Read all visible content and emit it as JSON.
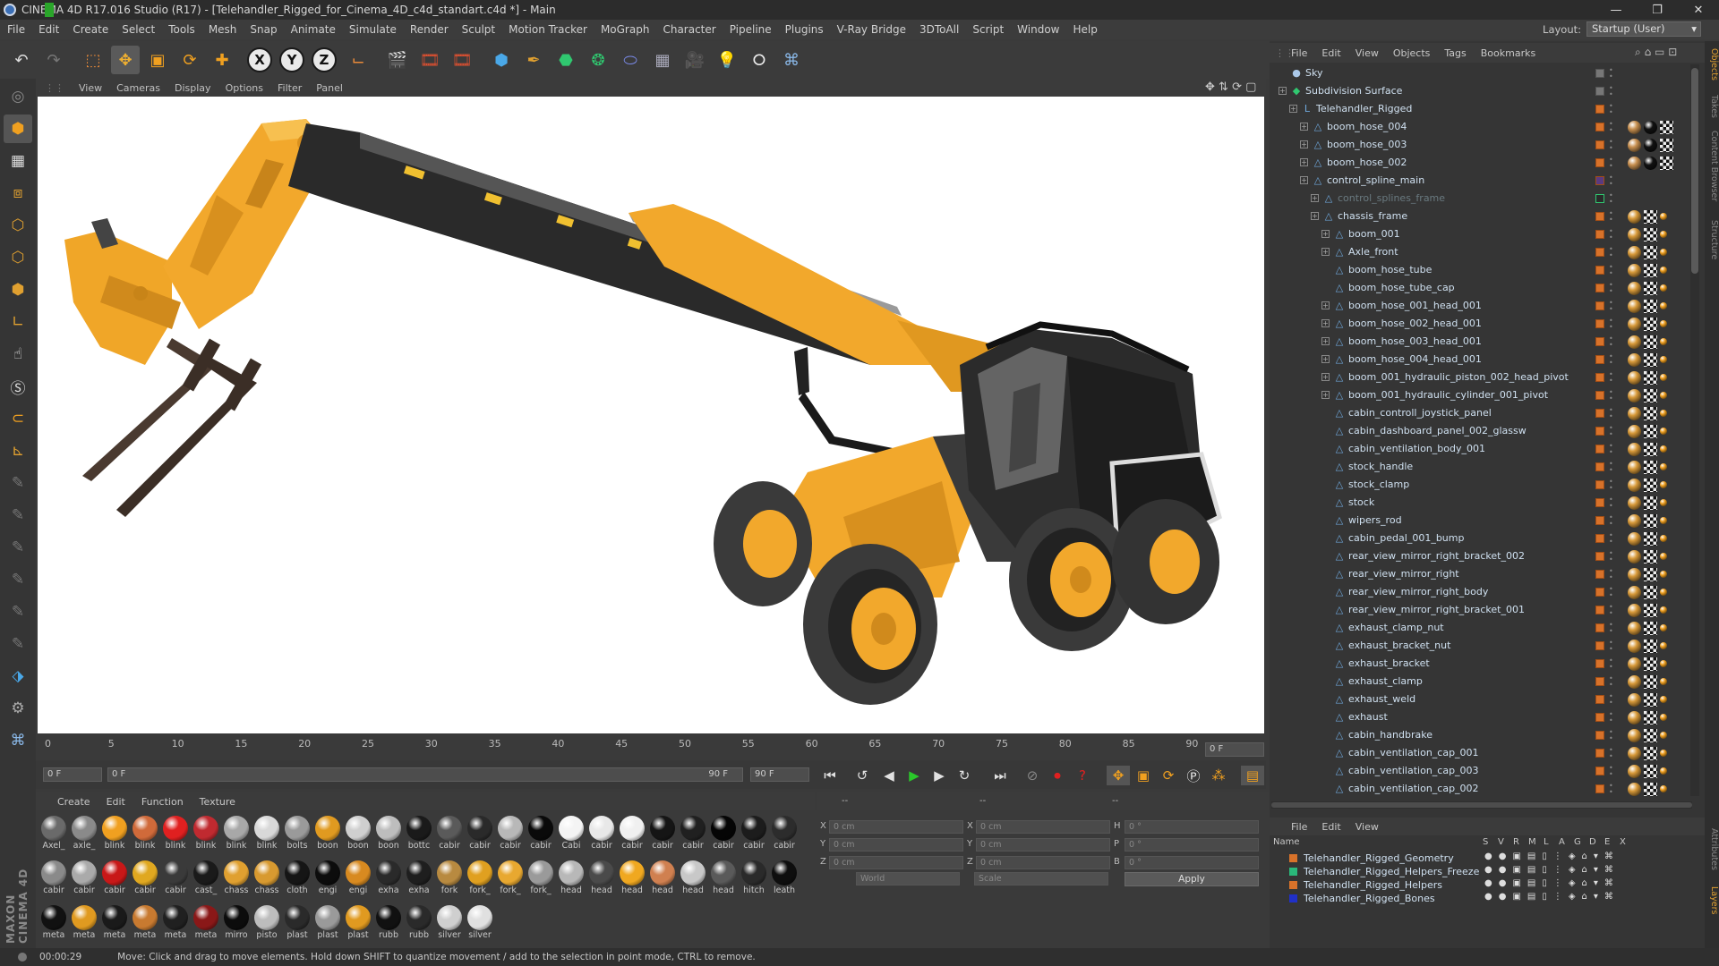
{
  "app": {
    "title": "CINEMA 4D R17.016 Studio (R17) - [Telehandler_Rigged_for_Cinema_4D_c4d_standart.c4d *] - Main"
  },
  "menu": [
    "File",
    "Edit",
    "Create",
    "Select",
    "Tools",
    "Mesh",
    "Snap",
    "Animate",
    "Simulate",
    "Render",
    "Sculpt",
    "Motion Tracker",
    "MoGraph",
    "Character",
    "Pipeline",
    "Plugins",
    "V-Ray Bridge",
    "3DToAll",
    "Script",
    "Window",
    "Help"
  ],
  "layout": {
    "label": "Layout:",
    "value": "Startup (User)"
  },
  "viewport": {
    "menu": [
      "View",
      "Cameras",
      "Display",
      "Options",
      "Filter",
      "Panel"
    ]
  },
  "timeline": {
    "ticks": [
      "0",
      "5",
      "10",
      "15",
      "20",
      "25",
      "30",
      "35",
      "40",
      "45",
      "50",
      "55",
      "60",
      "65",
      "70",
      "75",
      "80",
      "85",
      "90"
    ],
    "frame_end_display": "0 F"
  },
  "playback": {
    "start": "0 F",
    "range_start": "0 F",
    "range_end": "90 F",
    "end": "90 F"
  },
  "materials_menu": [
    "Create",
    "Edit",
    "Function",
    "Texture"
  ],
  "materials": [
    {
      "n": "Axel_",
      "c": "#6a6a6a"
    },
    {
      "n": "axle_",
      "c": "#8a8a8a"
    },
    {
      "n": "blink",
      "c": "#f0a020"
    },
    {
      "n": "blink",
      "c": "#d06a3a"
    },
    {
      "n": "blink",
      "c": "#e02020"
    },
    {
      "n": "blink",
      "c": "#c02a30"
    },
    {
      "n": "blink",
      "c": "#a8a8a8"
    },
    {
      "n": "blink",
      "c": "#d8d8d8"
    },
    {
      "n": "bolts",
      "c": "#9a9a9a"
    },
    {
      "n": "boon",
      "c": "#e09a20"
    },
    {
      "n": "boon",
      "c": "#cfcfcf"
    },
    {
      "n": "boon",
      "c": "#bdbdbd"
    },
    {
      "n": "bottc",
      "c": "#1a1a1a"
    },
    {
      "n": "cabir",
      "c": "#5a5a5a"
    },
    {
      "n": "cabir",
      "c": "#2a2a2a"
    },
    {
      "n": "cabir",
      "c": "#b8b8b8"
    },
    {
      "n": "cabir",
      "c": "#0a0a0a"
    },
    {
      "n": "Cabi",
      "c": "#f4f4f4"
    },
    {
      "n": "cabir",
      "c": "#e8e8e8"
    },
    {
      "n": "cabir",
      "c": "#f0f0f0"
    },
    {
      "n": "cabir",
      "c": "#151515"
    },
    {
      "n": "cabir",
      "c": "#202020"
    },
    {
      "n": "cabir",
      "c": "#050505"
    },
    {
      "n": "cabir",
      "c": "#1c1c1c"
    },
    {
      "n": "cabir",
      "c": "#2c2c2c"
    },
    {
      "n": "cabir",
      "c": "#8a8a8a"
    },
    {
      "n": "cabir",
      "c": "#aaaaaa"
    },
    {
      "n": "cabir",
      "c": "#c81818"
    },
    {
      "n": "cabir",
      "c": "#e0a820"
    },
    {
      "n": "cabir",
      "c": "#3a3a3a"
    },
    {
      "n": "cast_",
      "c": "#1a1a1a"
    },
    {
      "n": "chass",
      "c": "#e0a030"
    },
    {
      "n": "chass",
      "c": "#d89a30"
    },
    {
      "n": "cloth",
      "c": "#151515"
    },
    {
      "n": "engi",
      "c": "#0c0c0c"
    },
    {
      "n": "engi",
      "c": "#d88a20"
    },
    {
      "n": "exha",
      "c": "#2a2a2a"
    },
    {
      "n": "exha",
      "c": "#1e1e1e"
    },
    {
      "n": "fork",
      "c": "#b88a40"
    },
    {
      "n": "fork_",
      "c": "#e0a020"
    },
    {
      "n": "fork_",
      "c": "#e8a830"
    },
    {
      "n": "fork_",
      "c": "#9a9a9a"
    },
    {
      "n": "head",
      "c": "#b8b8b8"
    },
    {
      "n": "head",
      "c": "#4a4a4a"
    },
    {
      "n": "head",
      "c": "#f0a820"
    },
    {
      "n": "head",
      "c": "#d08050"
    },
    {
      "n": "head",
      "c": "#c8c8c8"
    },
    {
      "n": "head",
      "c": "#5a5a5a"
    },
    {
      "n": "hitch",
      "c": "#2a2a2a"
    },
    {
      "n": "leath",
      "c": "#0e0e0e"
    },
    {
      "n": "meta",
      "c": "#111111"
    },
    {
      "n": "meta",
      "c": "#e09a20"
    },
    {
      "n": "meta",
      "c": "#1a1a1a"
    },
    {
      "n": "meta",
      "c": "#c87a30"
    },
    {
      "n": "meta",
      "c": "#202020"
    },
    {
      "n": "meta",
      "c": "#8a1818"
    },
    {
      "n": "mirro",
      "c": "#0c0c0c"
    },
    {
      "n": "pisto",
      "c": "#bdbdbd"
    },
    {
      "n": "plast",
      "c": "#2a2a2a"
    },
    {
      "n": "plast",
      "c": "#9a9a9a"
    },
    {
      "n": "plast",
      "c": "#e09a20"
    },
    {
      "n": "rubb",
      "c": "#111111"
    },
    {
      "n": "rubb",
      "c": "#2a2a2a"
    },
    {
      "n": "silver",
      "c": "#cfcfcf"
    },
    {
      "n": "silver",
      "c": "#e0e0e0"
    }
  ],
  "coords": {
    "x": "0 cm",
    "y": "0 cm",
    "z": "0 cm",
    "x2": "0 cm",
    "y2": "0 cm",
    "z2": "0 cm",
    "h": "0 °",
    "p": "0 °",
    "b": "0 °",
    "mode1": "World",
    "mode2": "Scale",
    "apply": "Apply",
    "lx": "X",
    "ly": "Y",
    "lz": "Z",
    "lh": "H",
    "lp": "P",
    "lb": "B",
    "hdr": "--",
    "hdr2": "--",
    "hdr3": "--"
  },
  "status": {
    "time": "00:00:29",
    "text": "Move: Click and drag to move elements. Hold down SHIFT to quantize movement / add to the selection in point mode, CTRL to remove."
  },
  "objects_menu": [
    "File",
    "Edit",
    "View",
    "Objects",
    "Tags",
    "Bookmarks"
  ],
  "objects": [
    {
      "name": "Sky",
      "d": 0,
      "exp": false,
      "icon": "●",
      "dim": false
    },
    {
      "name": "Subdivision Surface",
      "d": 0,
      "exp": true,
      "icon": "◆",
      "dim": false
    },
    {
      "name": "Telehandler_Rigged",
      "d": 1,
      "exp": true,
      "icon": "L",
      "dim": false
    },
    {
      "name": "boom_hose_004",
      "d": 2,
      "exp": true,
      "icon": "△",
      "dim": false
    },
    {
      "name": "boom_hose_003",
      "d": 2,
      "exp": true,
      "icon": "△",
      "dim": false
    },
    {
      "name": "boom_hose_002",
      "d": 2,
      "exp": true,
      "icon": "△",
      "dim": false
    },
    {
      "name": "control_spline_main",
      "d": 2,
      "exp": true,
      "icon": "△",
      "dim": false
    },
    {
      "name": "control_splines_frame",
      "d": 3,
      "exp": true,
      "icon": "△",
      "dim": true
    },
    {
      "name": "chassis_frame",
      "d": 3,
      "exp": true,
      "icon": "△",
      "dim": false
    },
    {
      "name": "boom_001",
      "d": 4,
      "exp": true,
      "icon": "△",
      "dim": false
    },
    {
      "name": "Axle_front",
      "d": 4,
      "exp": true,
      "icon": "△",
      "dim": false
    },
    {
      "name": "boom_hose_tube",
      "d": 4,
      "exp": false,
      "icon": "△",
      "dim": false
    },
    {
      "name": "boom_hose_tube_cap",
      "d": 4,
      "exp": false,
      "icon": "△",
      "dim": false
    },
    {
      "name": "boom_hose_001_head_001",
      "d": 4,
      "exp": true,
      "icon": "△",
      "dim": false
    },
    {
      "name": "boom_hose_002_head_001",
      "d": 4,
      "exp": true,
      "icon": "△",
      "dim": false
    },
    {
      "name": "boom_hose_003_head_001",
      "d": 4,
      "exp": true,
      "icon": "△",
      "dim": false
    },
    {
      "name": "boom_hose_004_head_001",
      "d": 4,
      "exp": true,
      "icon": "△",
      "dim": false
    },
    {
      "name": "boom_001_hydraulic_piston_002_head_pivot",
      "d": 4,
      "exp": true,
      "icon": "△",
      "dim": false
    },
    {
      "name": "boom_001_hydraulic_cylinder_001_pivot",
      "d": 4,
      "exp": true,
      "icon": "△",
      "dim": false
    },
    {
      "name": "cabin_controll_joystick_panel",
      "d": 4,
      "exp": false,
      "icon": "△",
      "dim": false
    },
    {
      "name": "cabin_dashboard_panel_002_glassw",
      "d": 4,
      "exp": false,
      "icon": "△",
      "dim": false
    },
    {
      "name": "cabin_ventilation_body_001",
      "d": 4,
      "exp": false,
      "icon": "△",
      "dim": false
    },
    {
      "name": "stock_handle",
      "d": 4,
      "exp": false,
      "icon": "△",
      "dim": false
    },
    {
      "name": "stock_clamp",
      "d": 4,
      "exp": false,
      "icon": "△",
      "dim": false
    },
    {
      "name": "stock",
      "d": 4,
      "exp": false,
      "icon": "△",
      "dim": false
    },
    {
      "name": "wipers_rod",
      "d": 4,
      "exp": false,
      "icon": "△",
      "dim": false
    },
    {
      "name": "cabin_pedal_001_bump",
      "d": 4,
      "exp": false,
      "icon": "△",
      "dim": false
    },
    {
      "name": "rear_view_mirror_right_bracket_002",
      "d": 4,
      "exp": false,
      "icon": "△",
      "dim": false
    },
    {
      "name": "rear_view_mirror_right",
      "d": 4,
      "exp": false,
      "icon": "△",
      "dim": false
    },
    {
      "name": "rear_view_mirror_right_body",
      "d": 4,
      "exp": false,
      "icon": "△",
      "dim": false
    },
    {
      "name": "rear_view_mirror_right_bracket_001",
      "d": 4,
      "exp": false,
      "icon": "△",
      "dim": false
    },
    {
      "name": "exhaust_clamp_nut",
      "d": 4,
      "exp": false,
      "icon": "△",
      "dim": false
    },
    {
      "name": "exhaust_bracket_nut",
      "d": 4,
      "exp": false,
      "icon": "△",
      "dim": false
    },
    {
      "name": "exhaust_bracket",
      "d": 4,
      "exp": false,
      "icon": "△",
      "dim": false
    },
    {
      "name": "exhaust_clamp",
      "d": 4,
      "exp": false,
      "icon": "△",
      "dim": false
    },
    {
      "name": "exhaust_weld",
      "d": 4,
      "exp": false,
      "icon": "△",
      "dim": false
    },
    {
      "name": "exhaust",
      "d": 4,
      "exp": false,
      "icon": "△",
      "dim": false
    },
    {
      "name": "cabin_handbrake",
      "d": 4,
      "exp": false,
      "icon": "△",
      "dim": false
    },
    {
      "name": "cabin_ventilation_cap_001",
      "d": 4,
      "exp": false,
      "icon": "△",
      "dim": false
    },
    {
      "name": "cabin_ventilation_cap_003",
      "d": 4,
      "exp": false,
      "icon": "△",
      "dim": false
    },
    {
      "name": "cabin_ventilation_cap_002",
      "d": 4,
      "exp": false,
      "icon": "△",
      "dim": false
    }
  ],
  "layers_menu": [
    "File",
    "Edit",
    "View"
  ],
  "layers_cols": {
    "name": "Name",
    "flags": [
      "S",
      "V",
      "R",
      "M",
      "L",
      "A",
      "G",
      "D",
      "E",
      "X"
    ]
  },
  "layers": [
    {
      "name": "Telehandler_Rigged_Geometry",
      "color": "#d8722a"
    },
    {
      "name": "Telehandler_Rigged_Helpers_Freeze",
      "color": "#2ab87a"
    },
    {
      "name": "Telehandler_Rigged_Helpers",
      "color": "#d8722a"
    },
    {
      "name": "Telehandler_Rigged_Bones",
      "color": "#2030c8"
    }
  ],
  "side_tabs": [
    "Objects",
    "Takes",
    "Content Browser",
    "Structure",
    "Attributes",
    "Layers"
  ]
}
